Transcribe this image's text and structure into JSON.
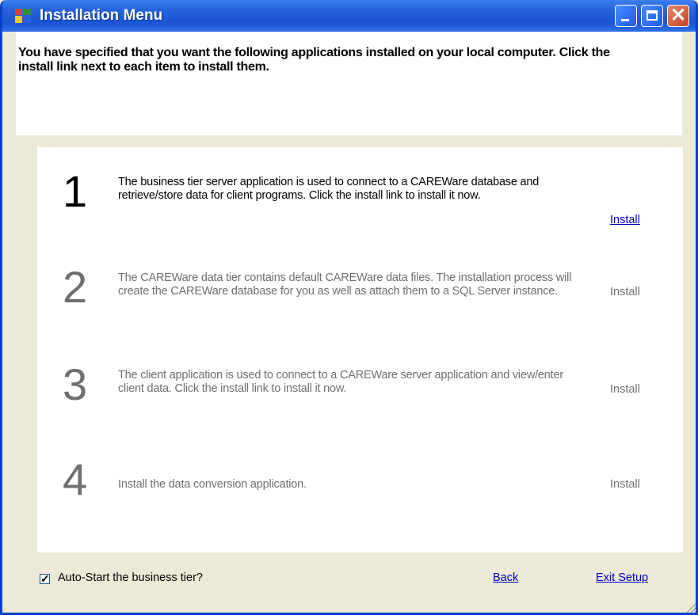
{
  "window": {
    "title": "Installation Menu",
    "close_glyph": "✕"
  },
  "header": {
    "message": "You have specified that you want the following applications installed on your local computer. Click the install link next to each item to install them."
  },
  "steps": [
    {
      "number": "1",
      "description": "The business tier server application is used to connect to a CAREWare database and retrieve/store data for client programs. Click the install link to install it now.",
      "install_label": "Install",
      "enabled": true
    },
    {
      "number": "2",
      "description": "The CAREWare data tier contains default CAREWare data files. The installation process will create the CAREWare database for you as well as attach them to a SQL Server instance.",
      "install_label": "Install",
      "enabled": false
    },
    {
      "number": "3",
      "description": "The client application is used to connect to a CAREWare server application and view/enter client data. Click the install link to install it now.",
      "install_label": "Install",
      "enabled": false
    },
    {
      "number": "4",
      "description": "Install the data conversion application.",
      "install_label": "Install",
      "enabled": false
    }
  ],
  "footer": {
    "autostart_label": "Auto-Start the business tier?",
    "autostart_checked": true,
    "checkmark_glyph": "✓",
    "back_label": "Back",
    "exit_label": "Exit Setup"
  },
  "colors": {
    "titlebar": "#2764dc",
    "link": "#0000cc",
    "disabled_text": "#6e6e6e",
    "window_bg": "#ece9d8"
  }
}
